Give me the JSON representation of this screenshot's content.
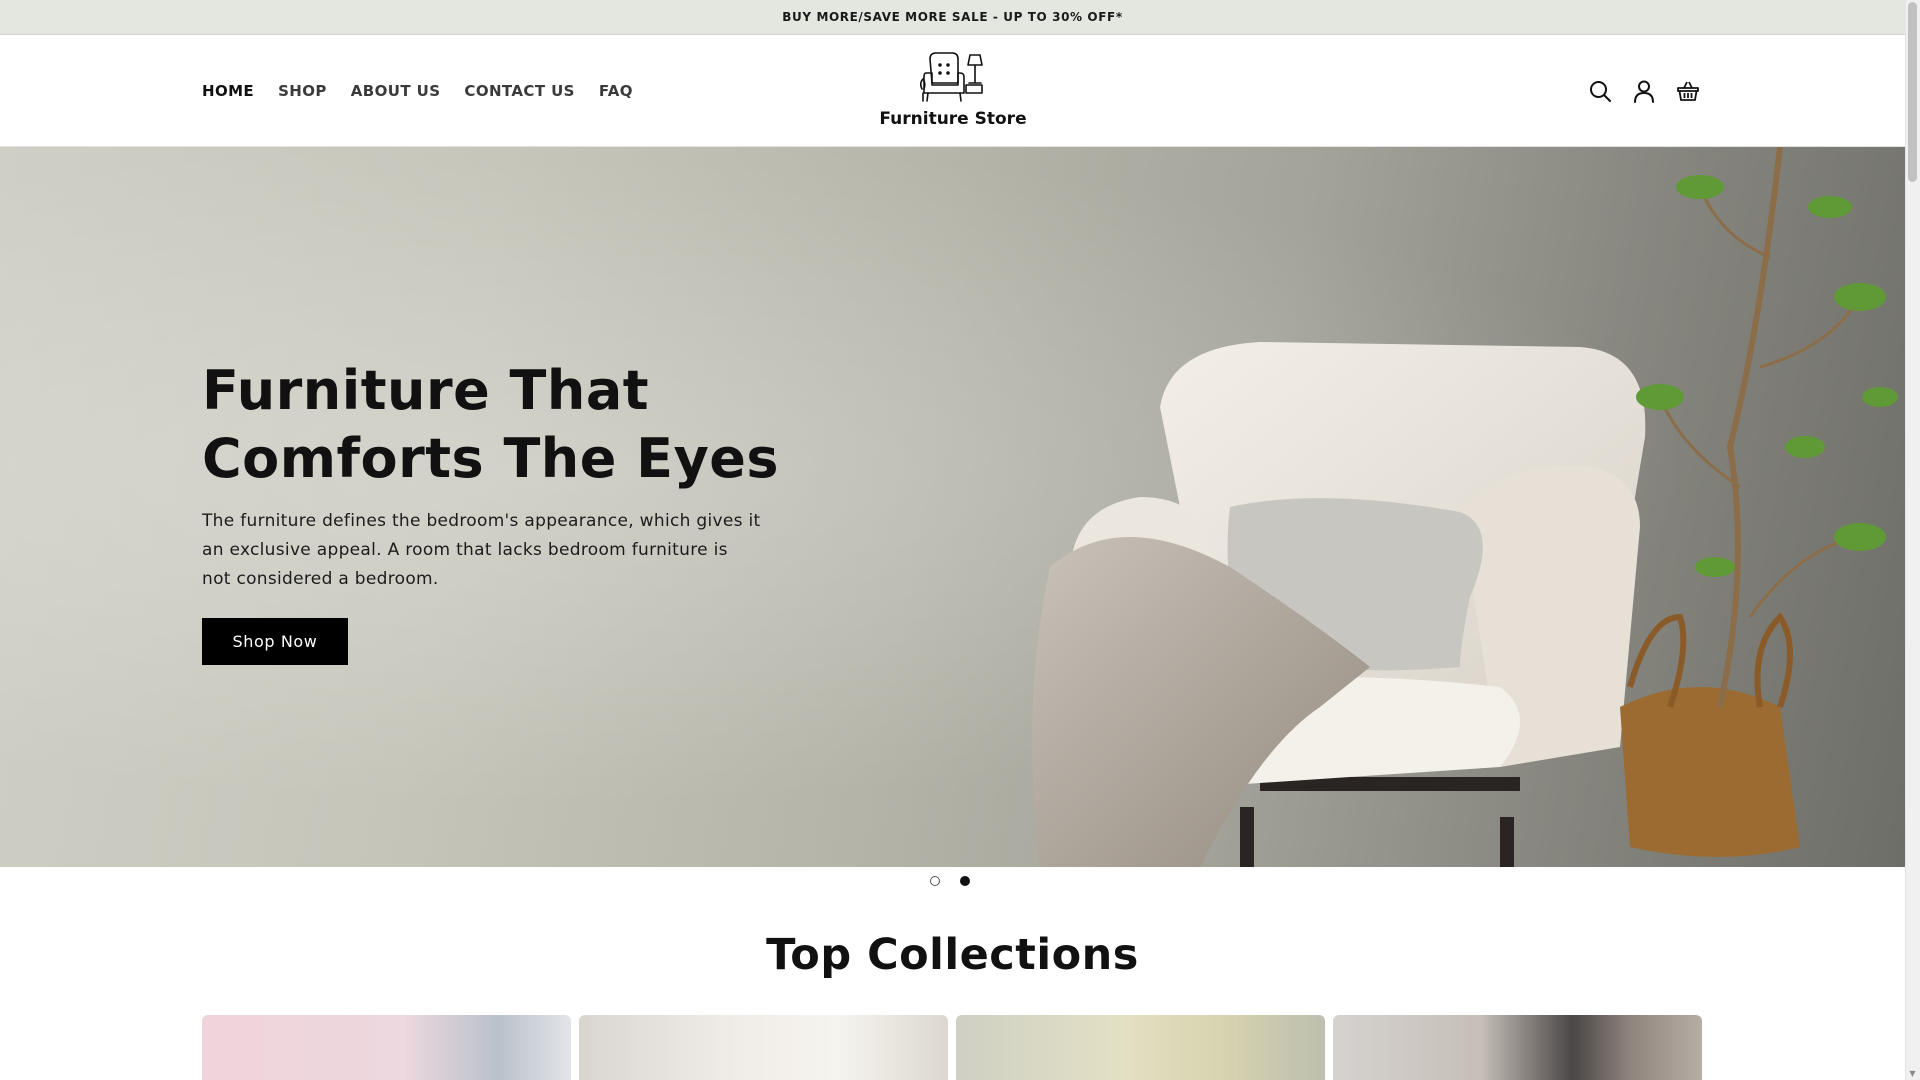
{
  "announcement": {
    "text": "BUY MORE/SAVE MORE SALE - UP TO 30% OFF*"
  },
  "nav": {
    "items": [
      {
        "label": "HOME"
      },
      {
        "label": "SHOP"
      },
      {
        "label": "ABOUT US"
      },
      {
        "label": "CONTACT US"
      },
      {
        "label": "FAQ"
      }
    ]
  },
  "logo": {
    "text": "Furniture Store"
  },
  "header_icons": [
    "search-icon",
    "account-icon",
    "cart-basket-icon"
  ],
  "hero": {
    "title_line1": "Furniture That",
    "title_line2": "Comforts The Eyes",
    "text": "The furniture defines the bedroom's appearance, which gives it an exclusive appeal. A room that lacks bedroom furniture is not considered a bedroom.",
    "button_label": "Shop Now"
  },
  "slider": {
    "slide_count": 2,
    "active_slide": 2
  },
  "collections": {
    "title": "Top Collections"
  },
  "colors": {
    "announcement_bg": "#e4e6e0",
    "button_bg": "#000000",
    "text": "#111111"
  }
}
